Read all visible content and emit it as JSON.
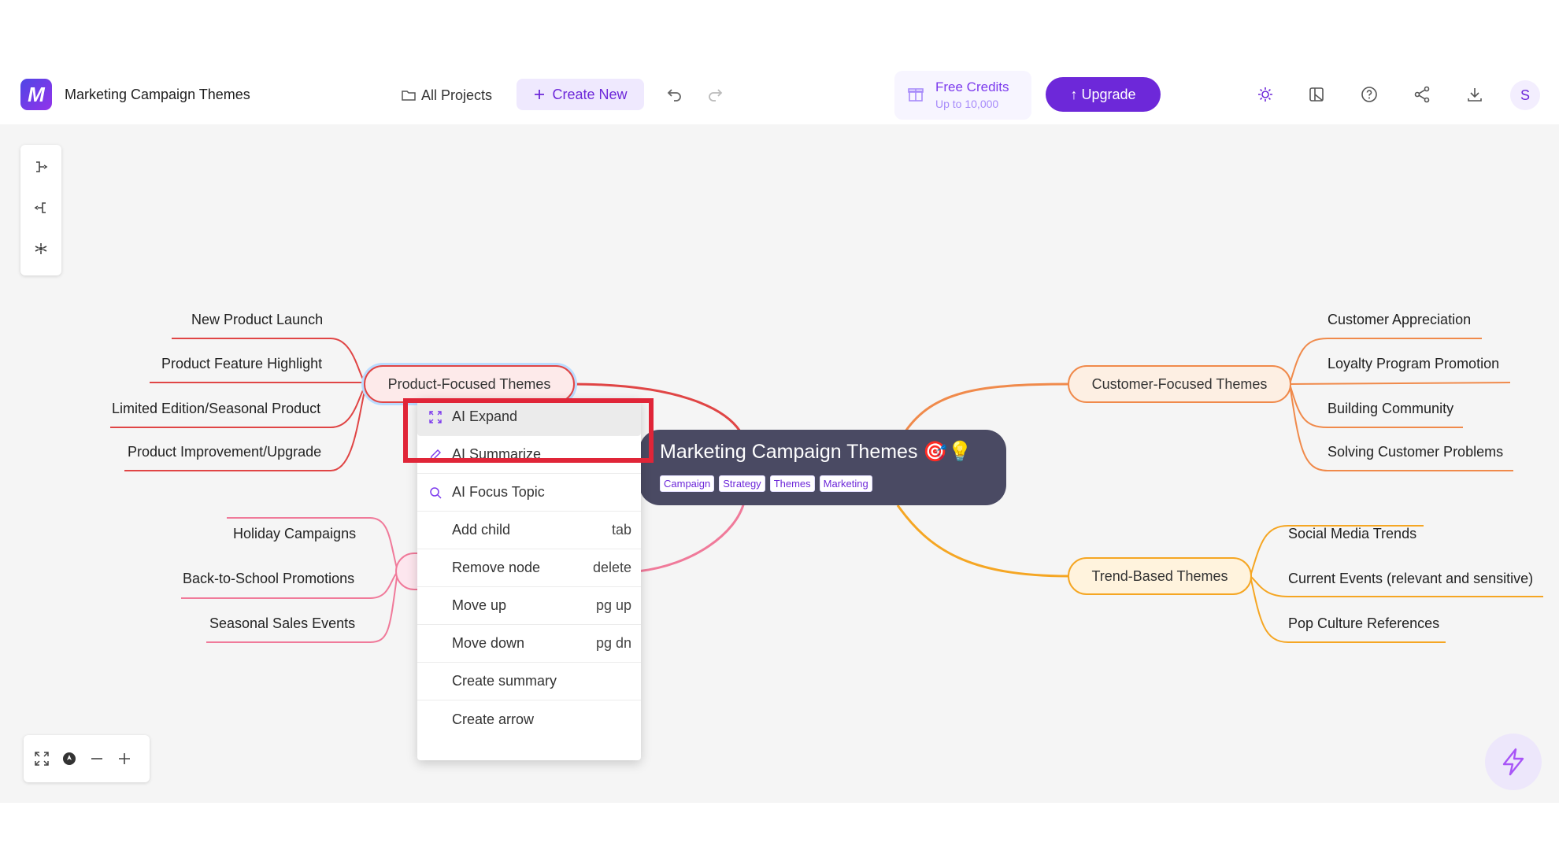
{
  "header": {
    "title": "Marketing Campaign Themes",
    "all_projects": "All Projects",
    "create_new": "Create New",
    "credits_title": "Free Credits",
    "credits_sub": "Up to 10,000",
    "upgrade": "↑ Upgrade",
    "avatar_initial": "S"
  },
  "root": {
    "title": "Marketing Campaign Themes 🎯💡",
    "tags": [
      "Campaign",
      "Strategy",
      "Themes",
      "Marketing"
    ]
  },
  "branches": {
    "product": {
      "label": "Product-Focused Themes",
      "children": [
        "New Product Launch",
        "Product Feature Highlight",
        "Limited Edition/Seasonal Product",
        "Product Improvement/Upgrade"
      ]
    },
    "seasonal": {
      "children": [
        "Holiday Campaigns",
        "Back-to-School Promotions",
        "Seasonal Sales Events"
      ]
    },
    "customer": {
      "label": "Customer-Focused Themes",
      "children": [
        "Customer Appreciation",
        "Loyalty Program Promotion",
        "Building Community",
        "Solving Customer Problems"
      ]
    },
    "trend": {
      "label": "Trend-Based Themes",
      "children": [
        "Social Media Trends",
        "Current Events (relevant and sensitive)",
        "Pop Culture References"
      ]
    }
  },
  "context_menu": {
    "items": [
      {
        "label": "AI Expand",
        "shortcut": ""
      },
      {
        "label": "AI Summarize",
        "shortcut": ""
      },
      {
        "label": "AI Focus Topic",
        "shortcut": ""
      },
      {
        "label": "Add child",
        "shortcut": "tab"
      },
      {
        "label": "Remove node",
        "shortcut": "delete"
      },
      {
        "label": "Move up",
        "shortcut": "pg up"
      },
      {
        "label": "Move down",
        "shortcut": "pg dn"
      },
      {
        "label": "Create summary",
        "shortcut": ""
      },
      {
        "label": "Create arrow",
        "shortcut": ""
      }
    ]
  },
  "colors": {
    "accent": "#6d28d9",
    "product_branch": "#e04545",
    "seasonal_branch": "#f07a9a",
    "customer_branch": "#f08a4b",
    "trend_branch": "#f5a623",
    "highlight": "#e02538",
    "root_bg": "#4a4a63"
  }
}
